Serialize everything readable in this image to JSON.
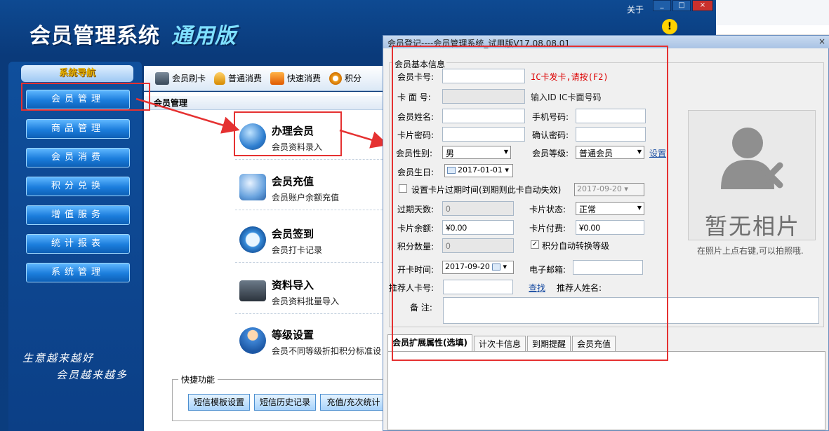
{
  "window": {
    "title": "会员管理系统",
    "edition": "通用版",
    "about": "关于",
    "win_buttons": [
      "_",
      "□",
      "×"
    ]
  },
  "sidenav": {
    "header": "系统导航",
    "items": [
      {
        "label": "会员管理"
      },
      {
        "label": "商品管理"
      },
      {
        "label": "会员消费"
      },
      {
        "label": "积分兑换"
      },
      {
        "label": "增值服务"
      },
      {
        "label": "统计报表"
      },
      {
        "label": "系统管理"
      }
    ],
    "slogan_line1": "生意越来越好",
    "slogan_line2": "会员越来越多"
  },
  "toolbar": {
    "items": [
      {
        "label": "会员刷卡",
        "icon": "card-icon"
      },
      {
        "label": "普通消费",
        "icon": "money-bag-icon"
      },
      {
        "label": "快速消费",
        "icon": "fast-pay-icon"
      },
      {
        "label": "积分",
        "icon": "refresh-icon"
      }
    ]
  },
  "content": {
    "title": "会员管理",
    "features": [
      {
        "title": "办理会员",
        "desc": "会员资料录入",
        "icon": "member-add-icon"
      },
      {
        "title": "会员充值",
        "desc": "会员账户余额充值",
        "icon": "recharge-icon"
      },
      {
        "title": "会员签到",
        "desc": "会员打卡记录",
        "icon": "checkin-clock-icon"
      },
      {
        "title": "资料导入",
        "desc": "会员资料批量导入",
        "icon": "import-laptop-icon"
      },
      {
        "title": "等级设置",
        "desc": "会员不同等级折扣积分标准设",
        "icon": "level-user-icon"
      }
    ],
    "quick_title": "快捷功能",
    "quick_buttons": [
      "短信模板设置",
      "短信历史记录",
      "充值/充次统计"
    ]
  },
  "dialog": {
    "title": "会员登记----会员管理系统_试用版V17.08.08.01",
    "close": "×",
    "group_label": "会员基本信息",
    "fields": {
      "card_no": {
        "label": "会员卡号:",
        "value": "",
        "hint": "IC卡发卡,请按(F2)"
      },
      "face_no": {
        "label": "卡 面 号:",
        "value": "",
        "hint": "输入ID IC卡面号码"
      },
      "name": {
        "label": "会员姓名:",
        "value": ""
      },
      "mobile": {
        "label": "手机号码:",
        "value": ""
      },
      "password": {
        "label": "卡片密码:",
        "value": ""
      },
      "confirm_password": {
        "label": "确认密码:",
        "value": ""
      },
      "gender": {
        "label": "会员性别:",
        "value": "男"
      },
      "level": {
        "label": "会员等级:",
        "value": "普通会员",
        "link": "设置"
      },
      "birthday": {
        "label": "会员生日:",
        "value": "2017-01-01"
      },
      "expire_check": {
        "label": "设置卡片过期时间(到期则此卡自动失效)",
        "checked": false,
        "date": "2017-09-20"
      },
      "expire_days": {
        "label": "过期天数:",
        "value": "0"
      },
      "card_status": {
        "label": "卡片状态:",
        "value": "正常"
      },
      "balance": {
        "label": "卡片余额:",
        "value": "¥0.00"
      },
      "card_fee": {
        "label": "卡片付费:",
        "value": "¥0.00"
      },
      "points": {
        "label": "积分数量:",
        "value": "0"
      },
      "auto_level": {
        "label": "积分自动转换等级",
        "checked": true
      },
      "open_date": {
        "label": "开卡时间:",
        "value": "2017-09-20"
      },
      "email": {
        "label": "电子邮箱:",
        "value": ""
      },
      "referrer_card": {
        "label": "推荐人卡号:",
        "value": "",
        "link": "查找"
      },
      "referrer_name": {
        "label": "推荐人姓名:"
      },
      "remark": {
        "label": "备  注:",
        "value": ""
      }
    },
    "photo": {
      "text": "暂无相片",
      "hint": "在照片上点右键,可以拍照哦."
    },
    "tabs": [
      "会员扩展属性(选填)",
      "计次卡信息",
      "到期提醒",
      "会员充值"
    ]
  },
  "colors": {
    "nav_bg": "#0c3f86",
    "nav_button": "#1b7ddc",
    "annotation_red": "#e53131",
    "hint_red": "#dd0000"
  }
}
